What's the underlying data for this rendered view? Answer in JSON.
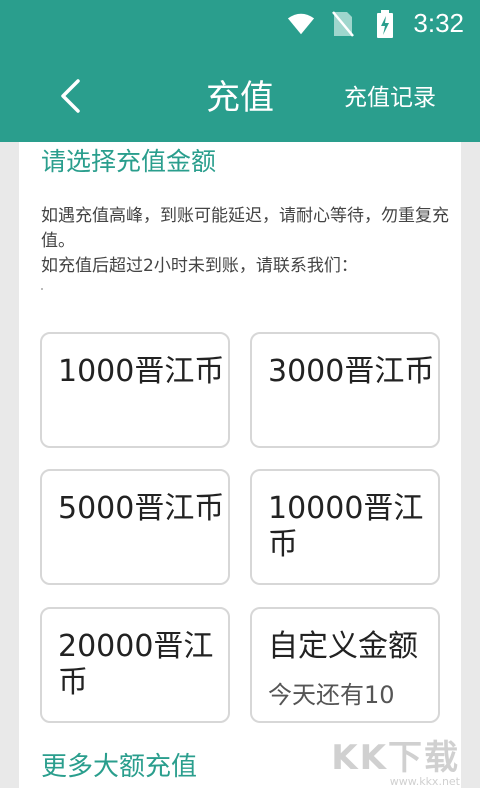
{
  "status_bar": {
    "time": "3:32",
    "icons": [
      "wifi-icon",
      "no-sim-icon",
      "battery-charging-icon"
    ]
  },
  "toolbar": {
    "back_icon": "chevron-left-icon",
    "title": "充值",
    "record_link": "充值记录"
  },
  "content": {
    "section_title": "请选择充值金额",
    "notice_lines": [
      "如遇充值高峰，到账可能延迟，请耐心等待，勿重复充值。",
      "如充值后超过2小时未到账，请联系我们："
    ],
    "options": [
      {
        "label": "1000晋江币"
      },
      {
        "label": "3000晋江币"
      },
      {
        "label": "5000晋江币"
      },
      {
        "label": "10000晋江币"
      },
      {
        "label": "20000晋江币"
      },
      {
        "label": "自定义金额",
        "subtitle": "今天还有10"
      }
    ],
    "more_link": "更多大额充值"
  },
  "watermark": {
    "logo": "KK下载",
    "url": "www.kkx.net"
  },
  "colors": {
    "primary": "#2a9e8d",
    "background": "#e9e9e9",
    "card": "#ffffff",
    "option_border": "#d7d7d7"
  }
}
